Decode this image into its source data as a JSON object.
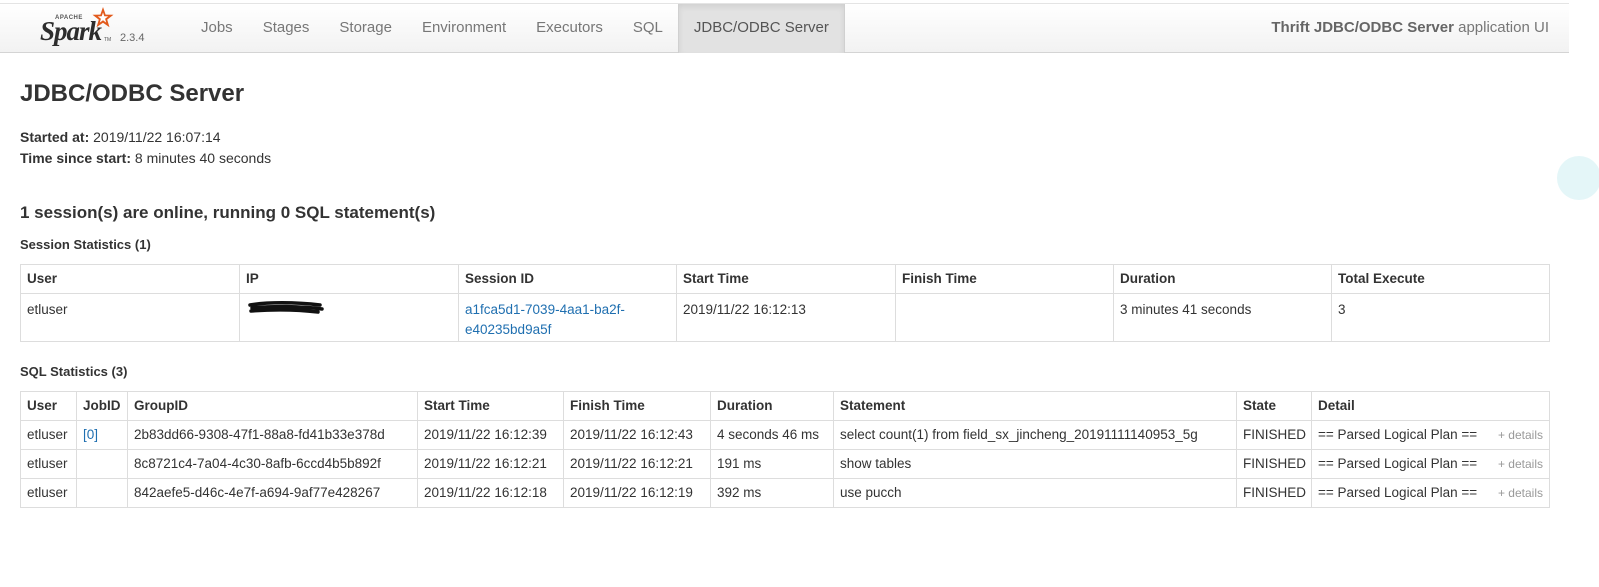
{
  "brand": {
    "apache": "APACHE",
    "name": "Spark",
    "version": "2.3.4",
    "tm": "TM"
  },
  "nav": {
    "tabs": [
      {
        "label": "Jobs"
      },
      {
        "label": "Stages"
      },
      {
        "label": "Storage"
      },
      {
        "label": "Environment"
      },
      {
        "label": "Executors"
      },
      {
        "label": "SQL"
      },
      {
        "label": "JDBC/ODBC Server",
        "active": true
      }
    ],
    "app_title_bold": "Thrift JDBC/ODBC Server",
    "app_title_rest": " application UI"
  },
  "page": {
    "title": "JDBC/ODBC Server",
    "started_label": "Started at:",
    "started_value": "2019/11/22 16:07:14",
    "elapsed_label": "Time since start:",
    "elapsed_value": "8 minutes 40 seconds",
    "summary": "1 session(s) are online, running 0 SQL statement(s)"
  },
  "session_stats": {
    "title": "Session Statistics (1)",
    "headers": [
      "User",
      "IP",
      "Session ID",
      "Start Time",
      "Finish Time",
      "Duration",
      "Total Execute"
    ],
    "rows": [
      {
        "user": "etluser",
        "ip": "",
        "session_id": "a1fca5d1-7039-4aa1-ba2f-e40235bd9a5f",
        "start_time": "2019/11/22 16:12:13",
        "finish_time": "",
        "duration": "3 minutes 41 seconds",
        "total_execute": "3"
      }
    ]
  },
  "sql_stats": {
    "title": "SQL Statistics (3)",
    "headers": [
      "User",
      "JobID",
      "GroupID",
      "Start Time",
      "Finish Time",
      "Duration",
      "Statement",
      "State",
      "Detail"
    ],
    "details_label": "+ details",
    "rows": [
      {
        "user": "etluser",
        "job_id": "[0]",
        "group_id": "2b83dd66-9308-47f1-88a8-fd41b33e378d",
        "start_time": "2019/11/22 16:12:39",
        "finish_time": "2019/11/22 16:12:43",
        "duration": "4 seconds 46 ms",
        "statement": "select count(1) from field_sx_jincheng_20191111140953_5g",
        "state": "FINISHED",
        "detail": "== Parsed Logical Plan =="
      },
      {
        "user": "etluser",
        "job_id": "",
        "group_id": "8c8721c4-7a04-4c30-8afb-6ccd4b5b892f",
        "start_time": "2019/11/22 16:12:21",
        "finish_time": "2019/11/22 16:12:21",
        "duration": "191 ms",
        "statement": "show tables",
        "state": "FINISHED",
        "detail": "== Parsed Logical Plan =="
      },
      {
        "user": "etluser",
        "job_id": "",
        "group_id": "842aefe5-d46c-4e7f-a694-9af77e428267",
        "start_time": "2019/11/22 16:12:18",
        "finish_time": "2019/11/22 16:12:19",
        "duration": "392 ms",
        "statement": "use pucch",
        "state": "FINISHED",
        "detail": "== Parsed Logical Plan =="
      }
    ]
  },
  "colors": {
    "link": "#1f6fb0",
    "logo_orange": "#e25a1c",
    "border": "#dddddd"
  }
}
